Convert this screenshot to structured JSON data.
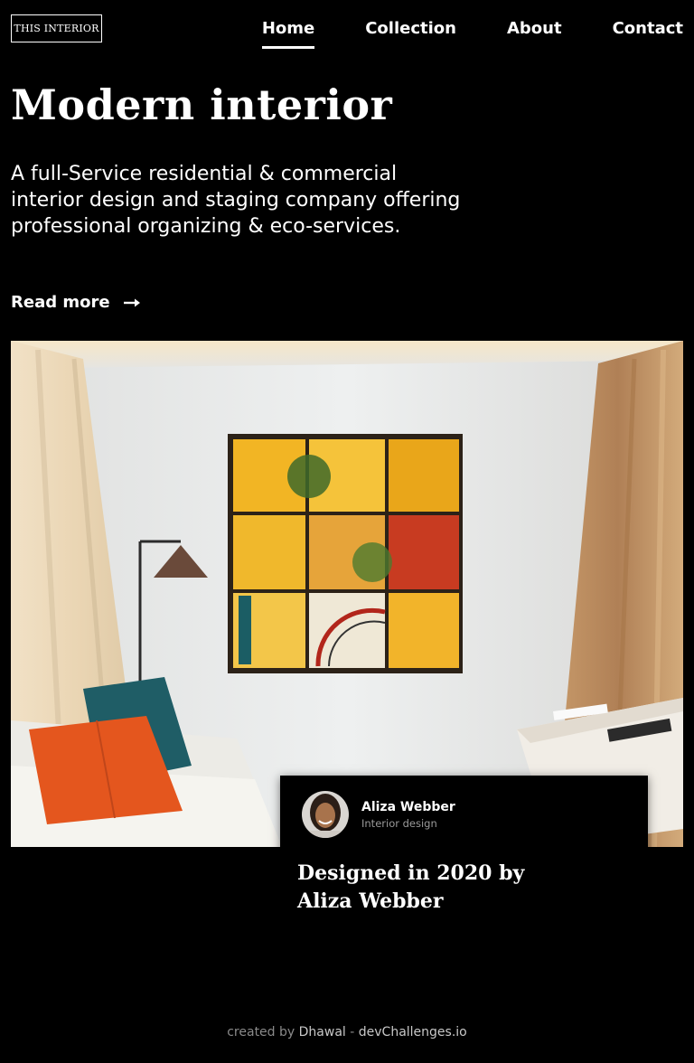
{
  "brand": {
    "logo_text": "THIS INTERIOR"
  },
  "nav": {
    "items": [
      {
        "label": "Home",
        "active": true
      },
      {
        "label": "Collection",
        "active": false
      },
      {
        "label": "About",
        "active": false
      },
      {
        "label": "Contact",
        "active": false
      }
    ]
  },
  "hero": {
    "title": "Modern interior",
    "lead": "A full-Service residential & commercial interior design and staging company offering professional organizing & eco-services.",
    "read_more": "Read more",
    "icons": {
      "arrow": "long-arrow-right-icon"
    }
  },
  "card": {
    "author_name": "Aliza Webber",
    "author_role": "Interior design",
    "title": "Designed in 2020 by Aliza Webber"
  },
  "footer": {
    "prefix": "created by",
    "author": "Dhawal",
    "separator": "-",
    "site": "devChallenges.io"
  },
  "colors": {
    "background": "#000000",
    "text": "#ffffff",
    "muted": "#8a8a8a"
  }
}
